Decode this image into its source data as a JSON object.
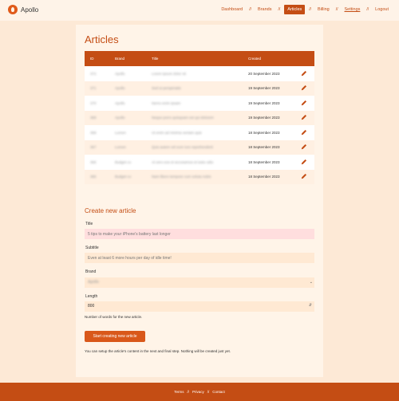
{
  "app": {
    "name": "Apollo"
  },
  "nav": {
    "items": [
      "Dashboard",
      "Brands",
      "Articles",
      "Billing",
      "Settings",
      "Logout"
    ],
    "separator": "//",
    "active": "Articles"
  },
  "page": {
    "title": "Articles"
  },
  "table": {
    "headers": [
      "ID",
      "Brand",
      "Title",
      "Created"
    ],
    "rows": [
      {
        "id": "372",
        "brand": "Apollo",
        "title": "Lorem ipsum dolor sit",
        "created": "20 September 2023"
      },
      {
        "id": "371",
        "brand": "Apollo",
        "title": "Sed ut perspiciatis",
        "created": "19 September 2023"
      },
      {
        "id": "370",
        "brand": "Apollo",
        "title": "Nemo enim ipsam",
        "created": "19 September 2023"
      },
      {
        "id": "369",
        "brand": "Apollo",
        "title": "Neque porro quisquam est qui dolorem",
        "created": "19 September 2023"
      },
      {
        "id": "368",
        "brand": "Lumen",
        "title": "Ut enim ad minima veniam quis",
        "created": "18 September 2023"
      },
      {
        "id": "367",
        "brand": "Lumen",
        "title": "Quis autem vel eum iure reprehenderit",
        "created": "18 September 2023"
      },
      {
        "id": "366",
        "brand": "Budget co",
        "title": "At vero eos et accusamus et iusto odio",
        "created": "18 September 2023"
      },
      {
        "id": "365",
        "brand": "Budget co",
        "title": "Nam libero tempore cum soluta nobis",
        "created": "18 September 2023"
      }
    ]
  },
  "form": {
    "title": "Create new article",
    "title_label": "Title",
    "title_placeholder": "5 tips to make your iPhone's battery last longer",
    "subtitle_label": "Subtitle",
    "subtitle_placeholder": "Even at least 6 more hours per day of idle time!",
    "brand_label": "Brand",
    "brand_value": "Apollo",
    "length_label": "Length",
    "length_value": "800",
    "length_help": "Number of words for the new article.",
    "submit_label": "Start creating new article",
    "note": "You can setup the article's content in the next and final step. Nothing will be created just yet."
  },
  "footer": {
    "links": [
      "Terms",
      "Privacy",
      "Contact"
    ],
    "separator": "//"
  },
  "colors": {
    "accent": "#c44d14",
    "button": "#d9581a",
    "background": "#fde9d6",
    "card": "#fff4e8"
  }
}
